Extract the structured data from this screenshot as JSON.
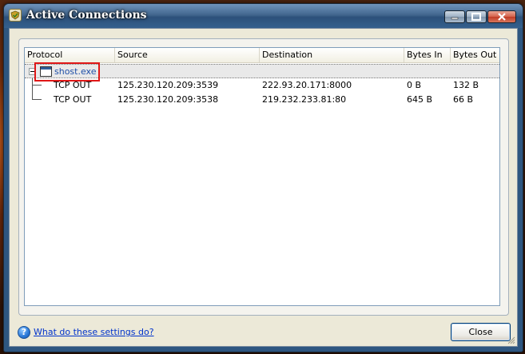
{
  "window": {
    "title": "Active Connections",
    "controls": {
      "minimize": "minimize",
      "maximize": "maximize",
      "close": "close"
    }
  },
  "table": {
    "columns": [
      "Protocol",
      "Source",
      "Destination",
      "Bytes In",
      "Bytes Out"
    ],
    "process": {
      "name": "shost.exe",
      "icon": "window-app-icon"
    },
    "rows": [
      {
        "protocol": "TCP OUT",
        "source": "125.230.120.209:3539",
        "destination": "222.93.20.171:8000",
        "bytes_in": "0 B",
        "bytes_out": "132 B"
      },
      {
        "protocol": "TCP OUT",
        "source": "125.230.120.209:3538",
        "destination": "219.232.233.81:80",
        "bytes_in": "645 B",
        "bytes_out": "66 B"
      }
    ]
  },
  "footer": {
    "help_link": "What do these settings do?",
    "close_label": "Close"
  },
  "colors": {
    "link": "#1f4fa8",
    "highlight": "#e01818",
    "titlebar": "#2c507a"
  }
}
